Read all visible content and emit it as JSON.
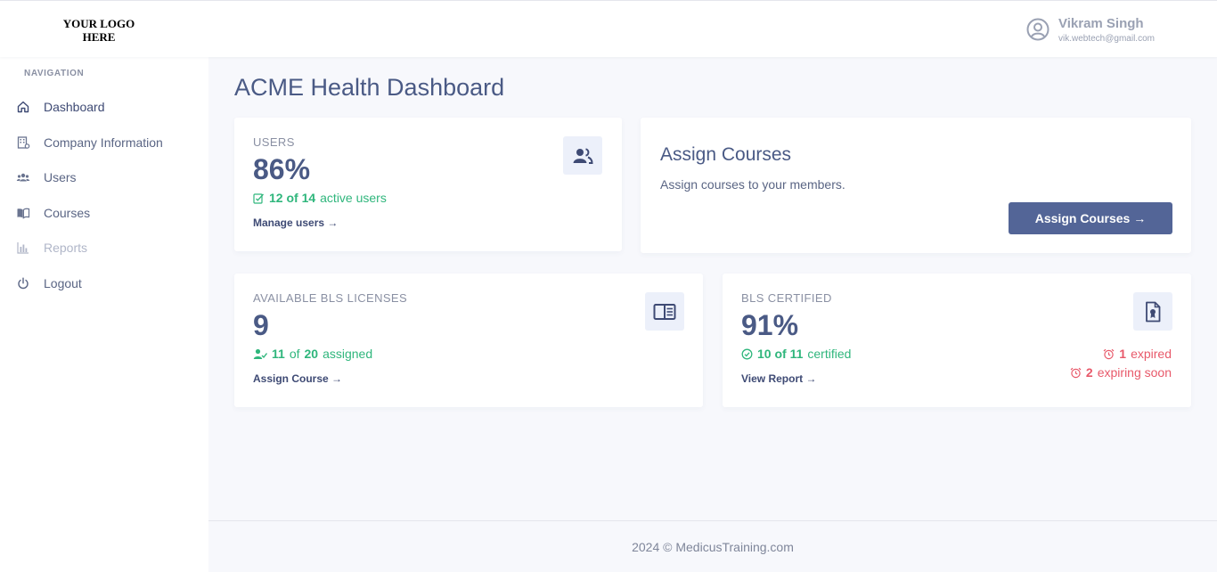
{
  "header": {
    "logo_text": "YOUR LOGO HERE",
    "user": {
      "name": "Vikram Singh",
      "email": "vik.webtech@gmail.com",
      "avatar_icon": "user-circle-icon"
    }
  },
  "sidebar": {
    "heading": "NAVIGATION",
    "items": [
      {
        "label": "Dashboard",
        "icon": "home-icon",
        "state": "active"
      },
      {
        "label": "Company Information",
        "icon": "building-icon",
        "state": "normal"
      },
      {
        "label": "Users",
        "icon": "users-icon",
        "state": "normal"
      },
      {
        "label": "Courses",
        "icon": "book-open-icon",
        "state": "normal"
      },
      {
        "label": "Reports",
        "icon": "bar-chart-icon",
        "state": "disabled"
      },
      {
        "label": "Logout",
        "icon": "power-icon",
        "state": "normal"
      }
    ]
  },
  "main": {
    "title": "ACME Health Dashboard",
    "users_card": {
      "label": "USERS",
      "value": "86%",
      "sub_count": "12 of 14",
      "sub_text": "active users",
      "link": "Manage users →",
      "icon": "users-icon"
    },
    "assign_card": {
      "title": "Assign Courses",
      "description": "Assign courses to your members.",
      "button": "Assign Courses →"
    },
    "licenses_card": {
      "label": "AVAILABLE BLS LICENSES",
      "value": "9",
      "sub_a": "11",
      "sub_of": "of",
      "sub_b": "20",
      "sub_text": "assigned",
      "link": "Assign Course →",
      "icon": "book-reader-icon"
    },
    "certified_card": {
      "label": "BLS CERTIFIED",
      "value": "91%",
      "sub_count": "10 of 11",
      "sub_text": "certified",
      "link": "View Report →",
      "icon": "certificate-file-icon",
      "expired_count": "1",
      "expired_text": "expired",
      "expiring_count": "2",
      "expiring_text": "expiring soon"
    }
  },
  "footer": {
    "text": "2024 © MedicusTraining.com"
  },
  "colors": {
    "accent": "#536597",
    "success": "#2fb67c",
    "danger": "#e8596a",
    "text": "#4a5a85"
  }
}
